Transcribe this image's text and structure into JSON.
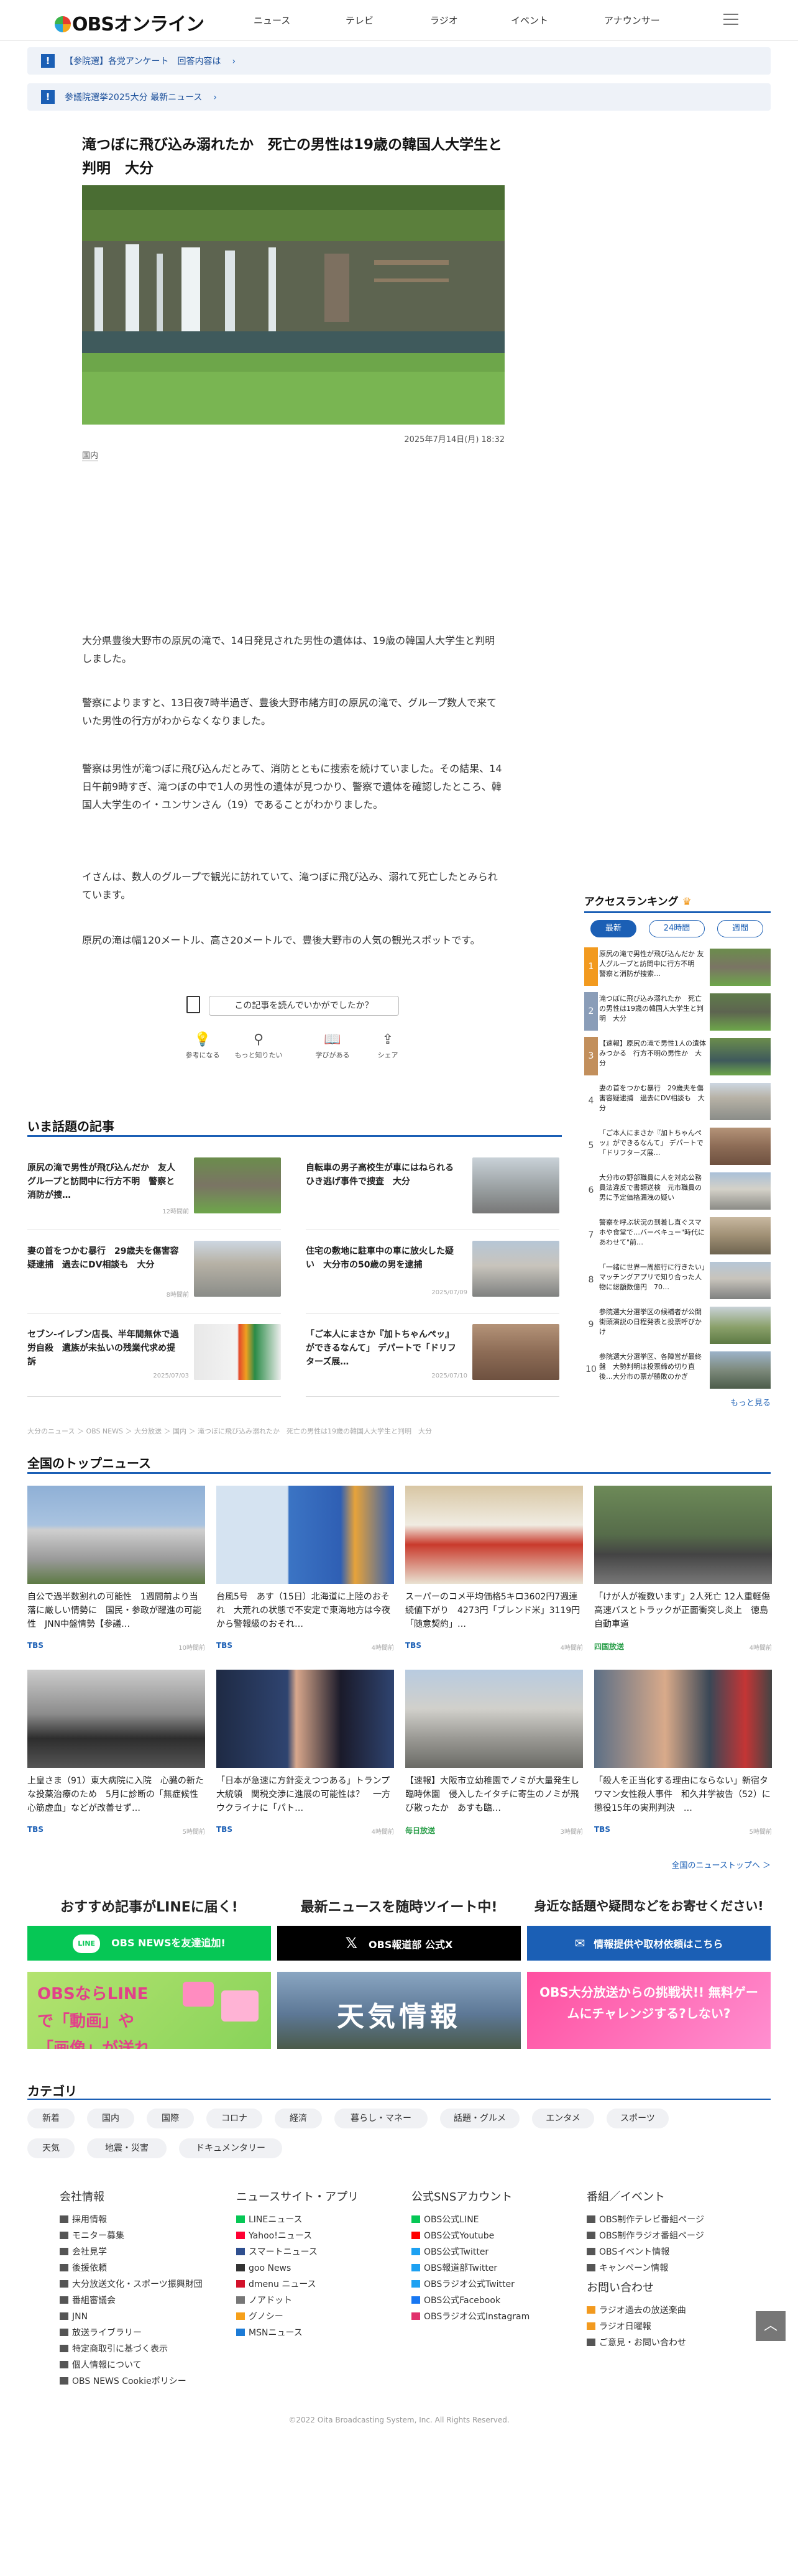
{
  "header": {
    "logo_text": "OBSオンライン",
    "nav": [
      "ニュース",
      "テレビ",
      "ラジオ",
      "イベント",
      "アナウンサー"
    ]
  },
  "notices": [
    "【参院選】各党アンケート　回答内容は",
    "参議院選挙2025大分 最新ニュース"
  ],
  "article": {
    "title": "滝つぼに飛び込み溺れたか　死亡の男性は19歳の韓国人大学生と判明　大分",
    "date": "2025年7月14日(月) 18:32",
    "category": "国内",
    "paragraphs": [
      "大分県豊後大野市の原尻の滝で、14日発見された男性の遺体は、19歳の韓国人大学生と判明しました。",
      "警察によりますと、13日夜7時半過ぎ、豊後大野市緒方町の原尻の滝で、グループ数人で来ていた男性の行方がわからなくなりました。",
      "警察は男性が滝つぼに飛び込んだとみて、消防とともに捜索を続けていました。その結果、14日午前9時すぎ、滝つぼの中で1人の男性の遺体が見つかり、警察で遺体を確認したところ、韓国人大学生のイ・ユンサンさん（19）であることがわかりました。",
      "イさんは、数人のグループで観光に訪れていて、滝つぼに飛び込み、溺れて死亡したとみられています。",
      "原尻の滝は幅120メートル、高さ20メートルで、豊後大野市の人気の観光スポットです。"
    ]
  },
  "feedback": {
    "question": "この記事を読んでいかがでしたか？",
    "options": [
      "参考になる",
      "もっと知りたい",
      "学びがある",
      "シェア"
    ]
  },
  "topics": {
    "title": "いま話題の記事",
    "items": [
      {
        "text": "原尻の滝で男性が飛び込んだか　友人グループと訪問中に行方不明　警察と消防が捜…",
        "date": "12時間前"
      },
      {
        "text": "自転車の男子高校生が車にはねられる　ひき逃げ事件で捜査　大分",
        "date": ""
      },
      {
        "text": "妻の首をつかむ暴行　29歳夫を傷害容疑逮捕　過去にDV相談も　大分",
        "date": "8時間前"
      },
      {
        "text": "住宅の敷地に駐車中の車に放火した疑い　大分市の50歳の男を逮捕",
        "date": "2025/07/09"
      },
      {
        "text": "セブン-イレブン店長、半年間無休で過労自殺　遺族が未払いの残業代求め提訴",
        "date": "2025/07/03"
      },
      {
        "text": "「ご本人にまさか『加トちゃんぺッ』ができるなんて」 デパートで「ドリフターズ展…",
        "date": "2025/07/10"
      }
    ]
  },
  "ranking": {
    "title": "アクセスランキング",
    "tabs": [
      "最新",
      "24時間",
      "週間"
    ],
    "more": "もっと見る",
    "items": [
      {
        "n": "1",
        "text": "原尻の滝で男性が飛び込んだか 友人グループと訪問中に行方不明　警察と消防が捜索…"
      },
      {
        "n": "2",
        "text": "滝つぼに飛び込み溺れたか　死亡の男性は19歳の韓国人大学生と判明　大分"
      },
      {
        "n": "3",
        "text": "【速報】原尻の滝で男性1人の遺体みつかる　行方不明の男性か　大分"
      },
      {
        "n": "4",
        "text": "妻の首をつかむ暴行　29歳夫を傷害容疑逮捕　過去にDV相談も　大分"
      },
      {
        "n": "5",
        "text": "「ご本人にまさか『加トちゃんぺッ』ができるなんて」 デパートで「ドリフターズ展…"
      },
      {
        "n": "6",
        "text": "大分市の野部職員に人を対応公務員法違反で書類送検　元市職員の男に予定価格漏洩の疑い"
      },
      {
        "n": "7",
        "text": "警察を呼ぶ状況の到着し直ぐスマホや食堂で…バーベキュー\"時代にあわせて\"前…"
      },
      {
        "n": "8",
        "text": "「一緒に世界一周旅行に行きたい」マッチングアプリで知り合った人物に総額数億円　70…"
      },
      {
        "n": "9",
        "text": "参院選大分選挙区の候補者が公開　街頭演説の日程発表と投票呼びかけ"
      },
      {
        "n": "10",
        "text": "参院選大分選挙区、各陣営が最終盤　大勢判明は投票締め切り直後…大分市の票が勝敗のかぎ"
      }
    ]
  },
  "breadcrumb": "大分のニュース ＞ OBS NEWS ＞ 大分放送 ＞ 国内 ＞ 滝つぼに飛び込み溺れたか　死亡の男性は19歳の韓国人大学生と判明　大分",
  "national": {
    "title": "全国のトップニュース",
    "more": "全国のニューストップへ ＞",
    "items": [
      {
        "text": "自公で過半数割れの可能性　1週間前より当落に厳しい情勢に　国民・参政が躍進の可能性　JNN中盤情勢【参議…",
        "src": "TBS",
        "date": "10時間前",
        "srcg": false
      },
      {
        "text": "台風5号　あす（15日）北海道に上陸のおそれ　大荒れの状態で不安定で東海地方は今夜から警報級のおそれ…",
        "src": "TBS",
        "date": "4時間前",
        "srcg": false
      },
      {
        "text": "スーパーのコメ平均価格5キロ3602円7週連続値下がり　4273円「ブレンド米」3119円「随意契約」…",
        "src": "TBS",
        "date": "4時間前",
        "srcg": false
      },
      {
        "text": "「けが人が複数います」2人死亡 12人重軽傷　高速バスとトラックが正面衝突し炎上　徳島自動車道",
        "src": "四国放送",
        "date": "4時間前",
        "srcg": true
      },
      {
        "text": "上皇さま（91）東大病院に入院　心臓の新たな投薬治療のため　5月に診断の「無症候性心筋虚血」などが改善せず…",
        "src": "TBS",
        "date": "5時間前",
        "srcg": false
      },
      {
        "text": "「日本が急速に方針変えつつある」トランプ大統領　関税交渉に進展の可能性は？　一方　ウクライナに「パト…",
        "src": "TBS",
        "date": "4時間前",
        "srcg": false
      },
      {
        "text": "【速報】大阪市立幼稚園でノミが大量発生し臨時休園　侵入したイタチに寄生のノミが飛び散ったか　あすも臨…",
        "src": "毎日放送",
        "date": "3時間前",
        "srcg": true
      },
      {
        "text": "「殺人を正当化する理由にならない」新宿タワマン女性殺人事件　和久井学被告（52）に懲役15年の実刑判決　…",
        "src": "TBS",
        "date": "5時間前",
        "srcg": false
      }
    ]
  },
  "promos": [
    {
      "heading": "おすすめ記事がLINEに届く!",
      "button": "OBS NEWSを友達追加!",
      "image_text": "OBSならLINEで「動画」や「画像」が送れる!"
    },
    {
      "heading": "最新ニュースを随時ツイート中!",
      "button": "OBS報道部 公式X",
      "image_text": "天気情報"
    },
    {
      "heading": "身近な話題や疑問などをお寄せください!",
      "button": "情報提供や取材依頼はこちら",
      "image_text": "OBS大分放送からの挑戦状!! 無料ゲームにチャレンジする?しない?"
    }
  ],
  "categories": {
    "title": "カテゴリ",
    "items": [
      "新着",
      "国内",
      "国際",
      "コロナ",
      "経済",
      "暮らし・マネー",
      "話題・グルメ",
      "エンタメ",
      "スポーツ",
      "天気",
      "地震・災害",
      "ドキュメンタリー"
    ]
  },
  "footer": {
    "cols": [
      {
        "title": "会社情報",
        "links": [
          "採用情報",
          "モニター募集",
          "会社見学",
          "後援依頼",
          "大分放送文化・スポーツ振興財団",
          "番組審議会",
          "JNN",
          "放送ライブラリー",
          "特定商取引に基づく表示",
          "個人情報について",
          "OBS NEWS Cookieポリシー"
        ]
      },
      {
        "title": "ニュースサイト・アプリ",
        "links": [
          "LINEニュース",
          "Yahoo!ニュース",
          "スマートニュース",
          "goo News",
          "dmenu ニュース",
          "ノアドット",
          "グノシー",
          "MSNニュース"
        ]
      },
      {
        "title": "公式SNSアカウント",
        "links": [
          "OBS公式LINE",
          "OBS公式Youtube",
          "OBS公式Twitter",
          "OBS報道部Twitter",
          "OBSラジオ公式Twitter",
          "OBS公式Facebook",
          "OBSラジオ公式Instagram"
        ]
      },
      {
        "title": "番組／イベント",
        "links": [
          "OBS制作テレビ番組ページ",
          "OBS制作ラジオ番組ページ",
          "OBSイベント情報",
          "キャンペーン情報"
        ]
      },
      {
        "title": "お問い合わせ",
        "links": [
          "ラジオ過去の放送楽曲",
          "ラジオ日曜報",
          "ご意見・お問い合わせ"
        ]
      }
    ],
    "copyright": "©2022  Oita Broadcasting System, Inc. All Rights Reserved."
  },
  "colors": {
    "accent": "#1b5fb5",
    "line": "#06c755",
    "x": "#000000",
    "rank_orange": "#f29a1f"
  }
}
